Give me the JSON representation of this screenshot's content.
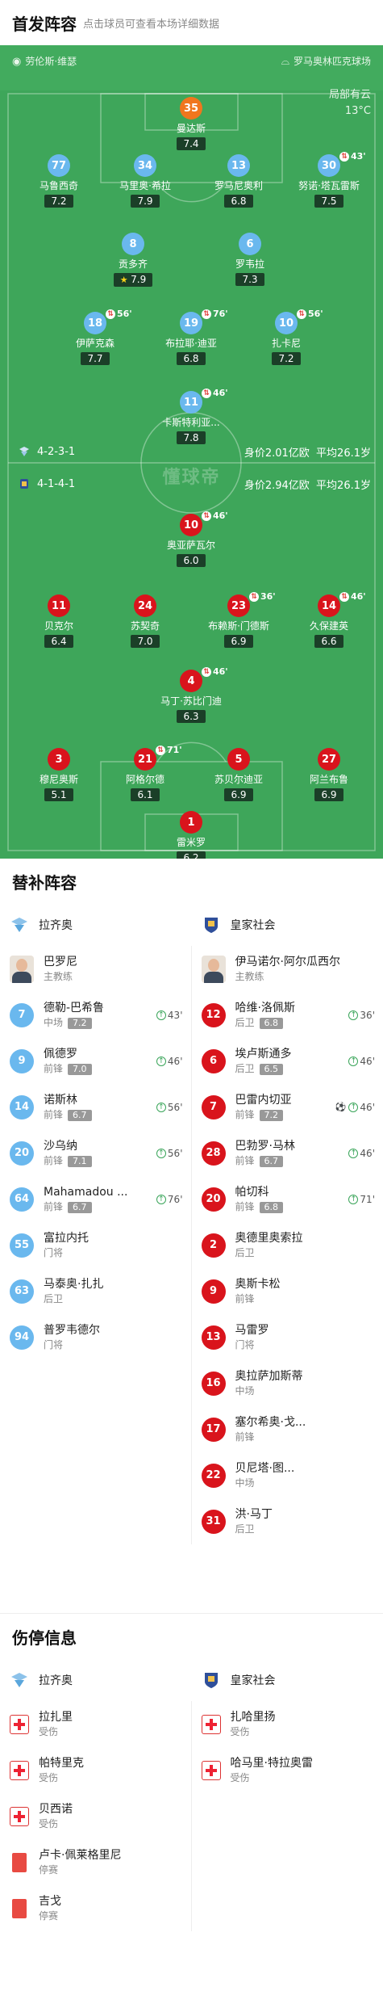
{
  "lineup_header": {
    "title": "首发阵容",
    "subtitle": "点击球员可查看本场详细数据"
  },
  "venue": {
    "referee": "劳伦斯·维瑟",
    "stadium": "罗马奥林匹克球场"
  },
  "weather": {
    "condition": "局部有云",
    "temp": "13°C"
  },
  "team_home": {
    "name": "拉齐奥",
    "formation": "4-2-3-1",
    "value": "身价2.01亿欧",
    "age": "平均26.1岁"
  },
  "team_away": {
    "name": "皇家社会",
    "formation": "4-1-4-1",
    "value": "身价2.94亿欧",
    "age": "平均26.1岁"
  },
  "watermark": "懂球帝",
  "home_players": [
    {
      "num": "35",
      "name": "曼达斯",
      "rating": "7.4",
      "gk": true
    },
    {
      "num": "77",
      "name": "马鲁西奇",
      "rating": "7.2"
    },
    {
      "num": "34",
      "name": "马里奥·希拉",
      "rating": "7.9"
    },
    {
      "num": "13",
      "name": "罗马尼奥利",
      "rating": "6.8"
    },
    {
      "num": "30",
      "name": "努诺·塔瓦雷斯",
      "rating": "7.5",
      "sub": "43'"
    },
    {
      "num": "8",
      "name": "贡多齐",
      "rating": "7.9",
      "star": true
    },
    {
      "num": "6",
      "name": "罗韦拉",
      "rating": "7.3"
    },
    {
      "num": "18",
      "name": "伊萨克森",
      "rating": "7.7",
      "sub": "56'"
    },
    {
      "num": "19",
      "name": "布拉耶·迪亚",
      "rating": "6.8",
      "sub": "76'"
    },
    {
      "num": "10",
      "name": "扎卡尼",
      "rating": "7.2",
      "sub": "56'"
    },
    {
      "num": "11",
      "name": "卡斯特利亚...",
      "rating": "7.8",
      "sub": "46'"
    }
  ],
  "away_players": [
    {
      "num": "10",
      "name": "奥亚萨瓦尔",
      "rating": "6.0",
      "sub": "46'"
    },
    {
      "num": "11",
      "name": "贝克尔",
      "rating": "6.4"
    },
    {
      "num": "24",
      "name": "苏契奇",
      "rating": "7.0"
    },
    {
      "num": "23",
      "name": "布赖斯·门德斯",
      "rating": "6.9",
      "sub": "36'"
    },
    {
      "num": "14",
      "name": "久保建英",
      "rating": "6.6",
      "sub": "46'"
    },
    {
      "num": "4",
      "name": "马丁·苏比门迪",
      "rating": "6.3",
      "sub": "46'"
    },
    {
      "num": "3",
      "name": "穆尼奥斯",
      "rating": "5.1"
    },
    {
      "num": "21",
      "name": "阿格尔德",
      "rating": "6.1",
      "sub": "71'"
    },
    {
      "num": "5",
      "name": "苏贝尔迪亚",
      "rating": "6.9"
    },
    {
      "num": "27",
      "name": "阿兰布鲁",
      "rating": "6.9"
    },
    {
      "num": "1",
      "name": "雷米罗",
      "rating": "6.2",
      "gk": true
    }
  ],
  "subs_header": {
    "title": "替补阵容"
  },
  "coaches": {
    "home": {
      "name": "巴罗尼",
      "role": "主教练"
    },
    "away": {
      "name": "伊马诺尔·阿尔瓜西尔",
      "role": "主教练"
    }
  },
  "subs_home": [
    {
      "num": "7",
      "name": "德勒-巴希鲁",
      "pos": "中场",
      "rating": "7.2",
      "time": "43'"
    },
    {
      "num": "9",
      "name": "佩德罗",
      "pos": "前锋",
      "rating": "7.0",
      "time": "46'"
    },
    {
      "num": "14",
      "name": "诺斯林",
      "pos": "前锋",
      "rating": "6.7",
      "time": "56'"
    },
    {
      "num": "20",
      "name": "沙乌纳",
      "pos": "前锋",
      "rating": "7.1",
      "time": "56'"
    },
    {
      "num": "64",
      "name": "Mahamadou ...",
      "pos": "前锋",
      "rating": "6.7",
      "time": "76'"
    },
    {
      "num": "55",
      "name": "富拉内托",
      "pos": "门将"
    },
    {
      "num": "63",
      "name": "马泰奥·扎扎",
      "pos": "后卫"
    },
    {
      "num": "94",
      "name": "普罗韦德尔",
      "pos": "门将"
    }
  ],
  "subs_away": [
    {
      "num": "12",
      "name": "哈维·洛佩斯",
      "pos": "后卫",
      "rating": "6.8",
      "time": "36'"
    },
    {
      "num": "6",
      "name": "埃卢斯通多",
      "pos": "后卫",
      "rating": "6.5",
      "time": "46'"
    },
    {
      "num": "7",
      "name": "巴雷内切亚",
      "pos": "前锋",
      "rating": "7.2",
      "time": "46'",
      "goal": true
    },
    {
      "num": "28",
      "name": "巴勃罗·马林",
      "pos": "前锋",
      "rating": "6.7",
      "time": "46'"
    },
    {
      "num": "20",
      "name": "帕切科",
      "pos": "前锋",
      "rating": "6.8",
      "time": "71'"
    },
    {
      "num": "2",
      "name": "奥德里奥索拉",
      "pos": "后卫"
    },
    {
      "num": "9",
      "name": "奥斯卡松",
      "pos": "前锋"
    },
    {
      "num": "13",
      "name": "马雷罗",
      "pos": "门将"
    },
    {
      "num": "16",
      "name": "奥拉萨加斯蒂",
      "pos": "中场"
    },
    {
      "num": "17",
      "name": "塞尔希奥·戈...",
      "pos": "前锋"
    },
    {
      "num": "22",
      "name": "贝尼塔·图...",
      "pos": "中场"
    },
    {
      "num": "31",
      "name": "洪·马丁",
      "pos": "后卫"
    }
  ],
  "inj_header": {
    "title": "伤停信息"
  },
  "inj_home": [
    {
      "name": "拉扎里",
      "status": "受伤",
      "type": "injury"
    },
    {
      "name": "帕特里克",
      "status": "受伤",
      "type": "injury"
    },
    {
      "name": "贝西诺",
      "status": "受伤",
      "type": "injury"
    },
    {
      "name": "卢卡·佩莱格里尼",
      "status": "停赛",
      "type": "red"
    },
    {
      "name": "吉戈",
      "status": "停赛",
      "type": "red"
    }
  ],
  "inj_away": [
    {
      "name": "扎哈里扬",
      "status": "受伤",
      "type": "injury"
    },
    {
      "name": "哈马里·特拉奥雷",
      "status": "受伤",
      "type": "injury"
    }
  ],
  "colors": {
    "pitch": "#3ea65a",
    "lazio": "#6ab8ee",
    "lazio_gk": "#f0761e",
    "real": "#d9141c"
  }
}
